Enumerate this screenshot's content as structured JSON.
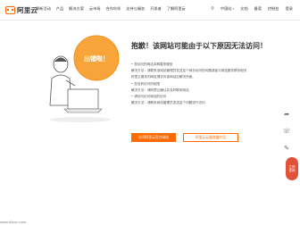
{
  "header": {
    "logo_text": "阿里云",
    "nav": [
      "最新活动",
      "产品",
      "解决方案",
      "云市场",
      "合作伙伴",
      "支持与服务",
      "开发者",
      "了解阿里云"
    ],
    "region": "中国站",
    "links": [
      "文档",
      "备案",
      "控制台",
      "登录"
    ]
  },
  "error": {
    "badge": "出错啦！",
    "title": "抱歉！该网站可能由于以下原因无法访问！",
    "items": [
      "• 您访问的网站本期暂停服务",
      "解决方法：请联系该网站管理员发送这个网页访问的问题或者与网站服务联系相关",
      "阿里云服务内网处理访问该网站应解决页面。",
      "• 您没有访问的权限",
      "解决方法：请阿里云确认并及时联系网站",
      "• 请访问访问网站的访问",
      "解决方法：请联系网站管理员发送这个问题进行访问"
    ],
    "primary_button": "访问阿里云官方网站",
    "secondary_button": "阿里云云服务器产品"
  },
  "float_button": "立即咨询",
  "footer_text": "www.aliyun.com"
}
